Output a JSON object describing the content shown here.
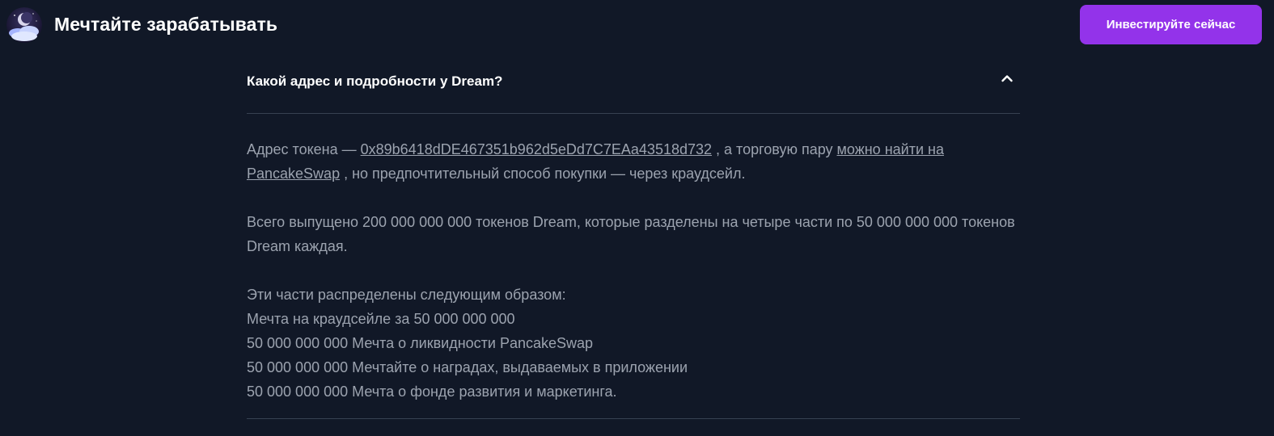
{
  "header": {
    "brand": "Мечтайте зарабатывать",
    "cta_label": "Инвестируйте сейчас"
  },
  "faq": {
    "question": "Какой адрес и подробности у Dream?",
    "answer": {
      "p1_prefix": "Адрес токена — ",
      "token_address": "0x89b6418dDE467351b962d5eDd7C7EAa43518d732",
      "p1_middle": " , а торговую пару ",
      "pancake_link": "можно найти на PancakeSwap",
      "p1_suffix": " , но предпочтительный способ покупки — через краудсейл.",
      "p2": "Всего выпущено 200 000 000 000 токенов Dream, которые разделены на четыре части по 50 000 000 000 токенов Dream каждая.",
      "p3_intro": "Эти части распределены следующим образом:",
      "items": [
        "Мечта на краудсейле за 50 000 000 000",
        "50 000 000 000 Мечта о ликвидности PancakeSwap",
        "50 000 000 000 Мечтайте о наградах, выдаваемых в приложении",
        "50 000 000 000 Мечта о фонде развития и маркетинга."
      ]
    }
  },
  "colors": {
    "background": "#111827",
    "accent": "#9333ea",
    "text_primary": "#ffffff",
    "text_secondary": "#9ca3af",
    "divider": "#374151"
  },
  "icons": {
    "logo": "moon-clouds-logo",
    "toggle": "chevron-up-icon"
  }
}
